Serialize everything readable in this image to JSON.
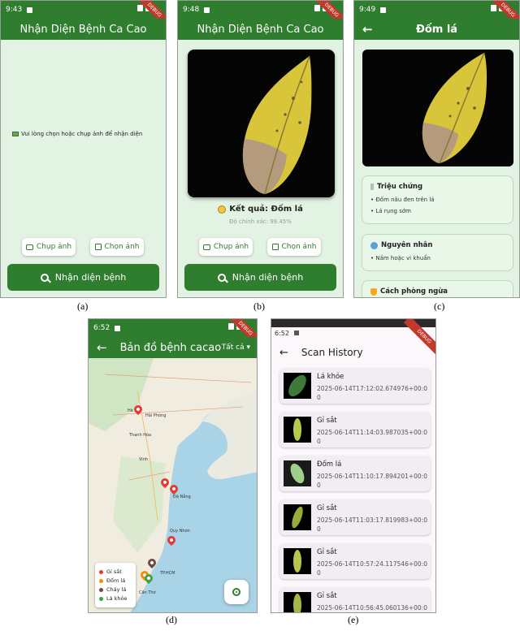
{
  "app": {
    "title": "Nhận Diện Bệnh Ca Cao",
    "ribbon": "DEBUG",
    "capture_label": "Chụp ảnh",
    "pick_label": "Chọn ảnh",
    "detect_label": "Nhận diện bệnh"
  },
  "screen_a": {
    "time": "9:43",
    "placeholder_icon": "image-icon",
    "placeholder": "Vui lòng chọn hoặc chụp ảnh để nhận diện",
    "caption": "(a)"
  },
  "screen_b": {
    "time": "9:48",
    "result_icon": "biohazard-icon",
    "result": "Kết quả: Đốm lá",
    "confidence": "Độ chính xác: 99.45%",
    "caption": "(b)"
  },
  "screen_c": {
    "time": "9:49",
    "title": "Đốm lá",
    "sections": [
      {
        "icon": "clipboard-icon",
        "title": "Triệu chứng",
        "items": [
          "Đốm nâu đen trên lá",
          "Lá rụng sớm"
        ]
      },
      {
        "icon": "bacteria-icon",
        "title": "Nguyên nhân",
        "items": [
          "Nấm hoặc vi khuẩn"
        ]
      },
      {
        "icon": "shield-icon",
        "title": "Cách phòng ngừa",
        "items": []
      }
    ],
    "caption": "(c)"
  },
  "screen_d": {
    "time": "6:52",
    "title": "Bản đồ bệnh cacao",
    "filter": "Tất cả",
    "map_labels": [
      "Hà Nội",
      "Hải Phòng",
      "Thanh Hóa",
      "Vinh",
      "Đà Nẵng",
      "Quy Nhơn",
      "TP.HCM",
      "Cần Thơ"
    ],
    "legend": [
      {
        "label": "Gỉ sắt",
        "color": "#e53935"
      },
      {
        "label": "Đốm lá",
        "color": "#fb8c00"
      },
      {
        "label": "Cháy lá",
        "color": "#6d4c41"
      },
      {
        "label": "Lá khỏe",
        "color": "#43a047"
      }
    ],
    "caption": "(d)"
  },
  "screen_e": {
    "time": "6:52",
    "title": "Scan History",
    "items": [
      {
        "name": "Lá khỏe",
        "timestamp": "2025-06-14T17:12:02.674976+00:00"
      },
      {
        "name": "Gỉ sắt",
        "timestamp": "2025-06-14T11:14:03.987035+00:00"
      },
      {
        "name": "Đốm lá",
        "timestamp": "2025-06-14T11:10:17.894201+00:00"
      },
      {
        "name": "Gỉ sắt",
        "timestamp": "2025-06-14T11:03:17.819983+00:00"
      },
      {
        "name": "Gỉ sắt",
        "timestamp": "2025-06-14T10:57:24.117546+00:00"
      },
      {
        "name": "Gỉ sắt",
        "timestamp": "2025-06-14T10:56:45.060136+00:00"
      }
    ],
    "caption": "(e)"
  },
  "colors": {
    "primary": "#2f7d2f",
    "background": "#e3f3e3",
    "debug": "#c0392b"
  }
}
